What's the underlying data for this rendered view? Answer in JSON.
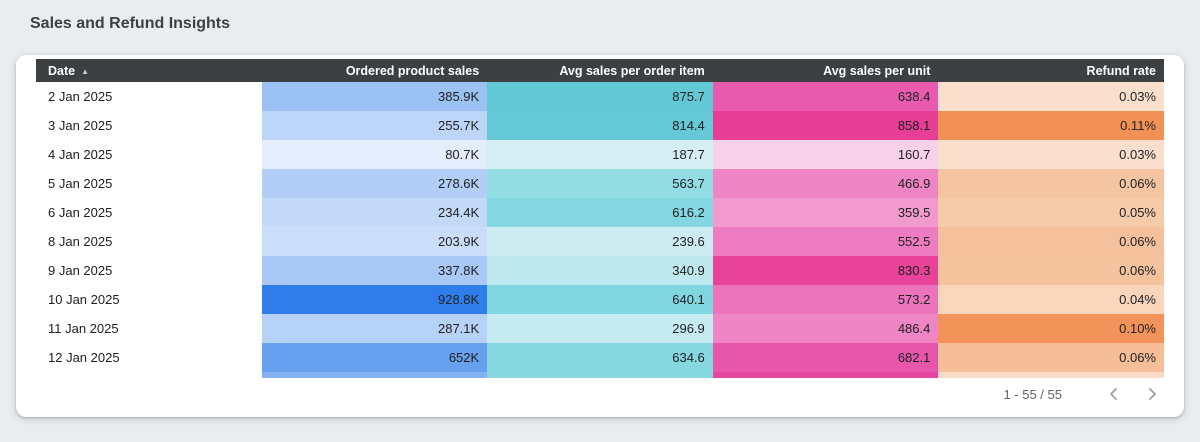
{
  "page": {
    "title": "Sales and Refund Insights"
  },
  "colors": {
    "page_bg": "#e9edf0",
    "card_bg": "#ffffff",
    "header_bg": "#3c4043",
    "title_color": "#3c4043",
    "chevron_color": "#9aa0a6",
    "heatmap_blue_max": "#2e7de9",
    "heatmap_teal_max": "#63c8d6",
    "heatmap_pink_max": "#e63d97",
    "heatmap_orange_max": "#f29155"
  },
  "table": {
    "columns": [
      {
        "label": "Date",
        "align": "left",
        "sorted": "asc"
      },
      {
        "label": "Ordered product sales",
        "align": "right"
      },
      {
        "label": "Avg sales per order item",
        "align": "right"
      },
      {
        "label": "Avg sales per unit",
        "align": "right"
      },
      {
        "label": "Refund rate",
        "align": "right"
      }
    ],
    "sort_icon": "▲",
    "rows": [
      {
        "date": "2 Jan 2025",
        "cells": [
          {
            "v": "385.9K",
            "bg": "#9cc2f4"
          },
          {
            "v": "875.7",
            "bg": "#63c8d6"
          },
          {
            "v": "638.4",
            "bg": "#e85aae"
          },
          {
            "v": "0.03%",
            "bg": "#fadfcd"
          }
        ]
      },
      {
        "date": "3 Jan 2025",
        "cells": [
          {
            "v": "255.7K",
            "bg": "#bdd6f8"
          },
          {
            "v": "814.4",
            "bg": "#66c9d7"
          },
          {
            "v": "858.1",
            "bg": "#e63d97"
          },
          {
            "v": "0.11%",
            "bg": "#f29155"
          }
        ]
      },
      {
        "date": "4 Jan 2025",
        "cells": [
          {
            "v": "80.7K",
            "bg": "#e4edfb"
          },
          {
            "v": "187.7",
            "bg": "#d5eef4"
          },
          {
            "v": "160.7",
            "bg": "#f8d0e8"
          },
          {
            "v": "0.03%",
            "bg": "#fadfcd"
          }
        ]
      },
      {
        "date": "5 Jan 2025",
        "cells": [
          {
            "v": "278.6K",
            "bg": "#b2cef6"
          },
          {
            "v": "563.7",
            "bg": "#92dce4"
          },
          {
            "v": "466.9",
            "bg": "#ee86c6"
          },
          {
            "v": "0.06%",
            "bg": "#f5c4a1"
          }
        ]
      },
      {
        "date": "6 Jan 2025",
        "cells": [
          {
            "v": "234.4K",
            "bg": "#c3d9f8"
          },
          {
            "v": "616.2",
            "bg": "#84d6e0"
          },
          {
            "v": "359.5",
            "bg": "#f09acd"
          },
          {
            "v": "0.05%",
            "bg": "#f6cbaa"
          }
        ]
      },
      {
        "date": "8 Jan 2025",
        "cells": [
          {
            "v": "203.9K",
            "bg": "#cbdef9"
          },
          {
            "v": "239.6",
            "bg": "#cdecf2"
          },
          {
            "v": "552.5",
            "bg": "#ed7cc1"
          },
          {
            "v": "0.06%",
            "bg": "#f5c09c"
          }
        ]
      },
      {
        "date": "9 Jan 2025",
        "cells": [
          {
            "v": "337.8K",
            "bg": "#a9c8f5"
          },
          {
            "v": "340.9",
            "bg": "#bfe7ee"
          },
          {
            "v": "830.3",
            "bg": "#e74399"
          },
          {
            "v": "0.06%",
            "bg": "#f5c29e"
          }
        ]
      },
      {
        "date": "10 Jan 2025",
        "cells": [
          {
            "v": "928.8K",
            "bg": "#2e7de9"
          },
          {
            "v": "640.1",
            "bg": "#80d5de"
          },
          {
            "v": "573.2",
            "bg": "#ec74bd"
          },
          {
            "v": "0.04%",
            "bg": "#f8d5bb"
          }
        ]
      },
      {
        "date": "11 Jan 2025",
        "cells": [
          {
            "v": "287.1K",
            "bg": "#b7d2f7"
          },
          {
            "v": "296.9",
            "bg": "#c5eaf0"
          },
          {
            "v": "486.4",
            "bg": "#ee85c5"
          },
          {
            "v": "0.10%",
            "bg": "#f29359"
          }
        ]
      },
      {
        "date": "12 Jan 2025",
        "cells": [
          {
            "v": "652K",
            "bg": "#66a0ee"
          },
          {
            "v": "634.6",
            "bg": "#85d7e0"
          },
          {
            "v": "682.1",
            "bg": "#e756ab"
          },
          {
            "v": "0.06%",
            "bg": "#f5bd98"
          }
        ]
      }
    ],
    "partial_row_colors": [
      "#84b1f1",
      "#87d8e1",
      "#e4459f",
      "#f8dbc6"
    ],
    "pagination": {
      "range_label": "1 - 55 / 55",
      "prev_icon": "chevron-left-icon",
      "next_icon": "chevron-right-icon"
    }
  }
}
